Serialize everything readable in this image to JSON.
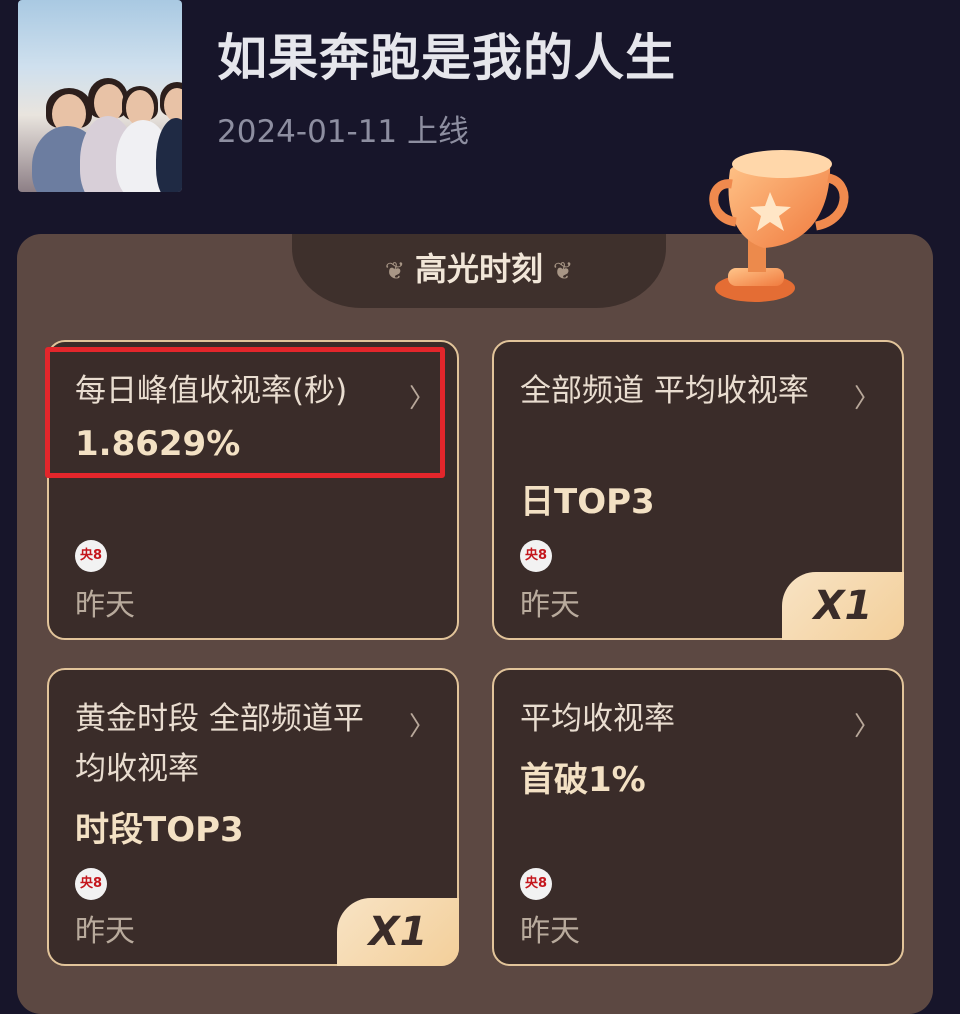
{
  "header": {
    "title": "如果奔跑是我的人生",
    "release_date": "2024-01-11 上线"
  },
  "section": {
    "title": "高光时刻"
  },
  "cards": [
    {
      "label": "每日峰值收视率(秒)",
      "value": "1.8629%",
      "channel": "央8",
      "time": "昨天",
      "badge": ""
    },
    {
      "label": "全部频道 平均收视率",
      "value": "日TOP3",
      "channel": "央8",
      "time": "昨天",
      "badge": "X1"
    },
    {
      "label": "黄金时段 全部频道平均收视率",
      "value": "时段TOP3",
      "channel": "央8",
      "time": "昨天",
      "badge": "X1"
    },
    {
      "label": "平均收视率",
      "value": "首破1%",
      "channel": "央8",
      "time": "昨天",
      "badge": ""
    }
  ],
  "colors": {
    "background": "#17152a",
    "panel": "#5c4842",
    "card": "#3a2c29",
    "card_border": "#e2c49a",
    "highlight": "#e3262b"
  },
  "icons": {
    "chevron": "chevron-right-icon",
    "trophy": "trophy-icon",
    "channel": "cctv8-logo-icon"
  }
}
